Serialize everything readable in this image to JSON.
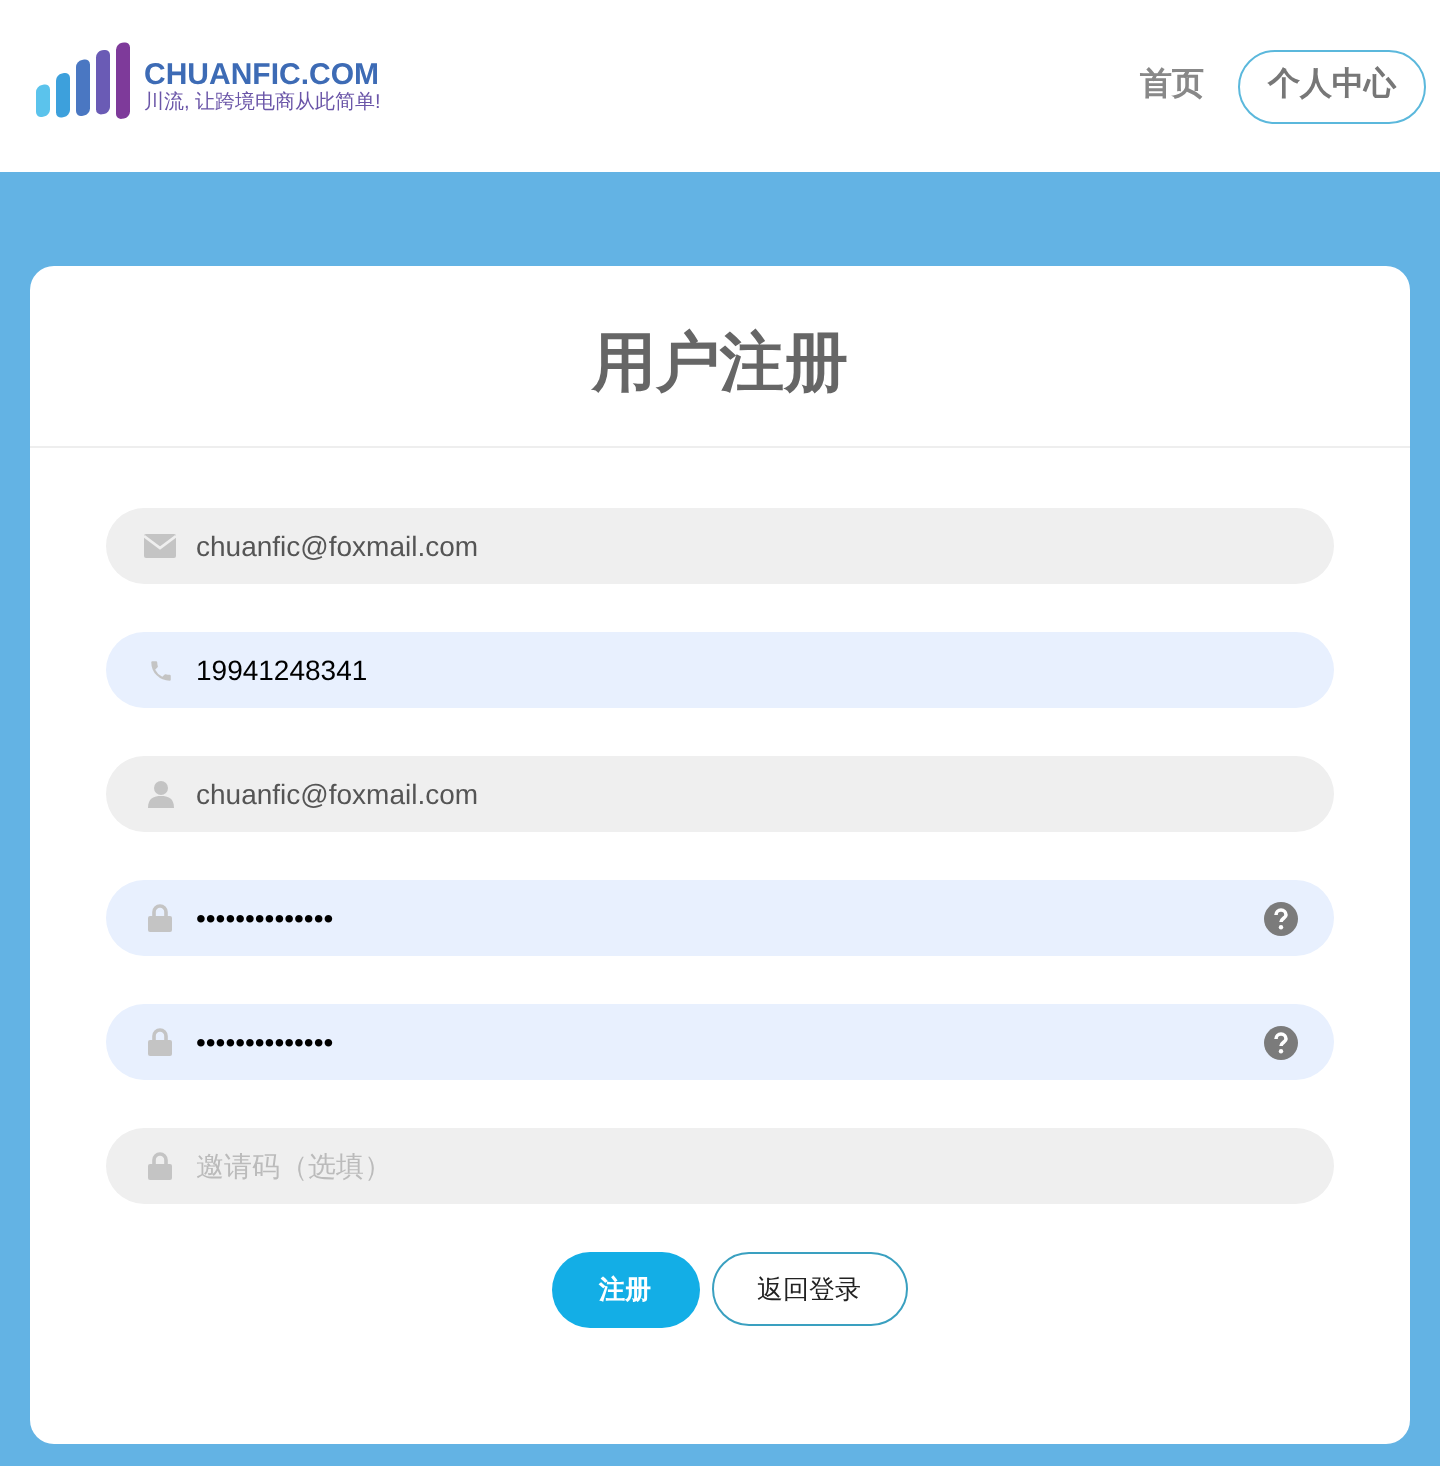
{
  "header": {
    "logo": {
      "name": "CHUANFIC.COM",
      "slogan": "川流, 让跨境电商从此简单!"
    },
    "nav": [
      {
        "label": "首页",
        "selected": false
      },
      {
        "label": "个人中心",
        "selected": true
      }
    ]
  },
  "form": {
    "title": "用户注册",
    "fields": [
      {
        "kind": "mail",
        "value": "chuanfic@foxmail.com",
        "autofilled": false,
        "help": false
      },
      {
        "kind": "phone",
        "value": "19941248341",
        "autofilled": true,
        "help": false
      },
      {
        "kind": "user",
        "value": "chuanfic@foxmail.com",
        "autofilled": false,
        "help": false
      },
      {
        "kind": "lock",
        "value": "••••••••••••••",
        "autofilled": true,
        "help": true
      },
      {
        "kind": "lock",
        "value": "••••••••••••••",
        "autofilled": true,
        "help": true
      },
      {
        "kind": "lock",
        "placeholder": "邀请码（选填）",
        "autofilled": false,
        "help": false
      }
    ],
    "buttons": [
      {
        "label": "注册",
        "kind": "primary"
      },
      {
        "label": "返回登录",
        "kind": "outline"
      }
    ]
  }
}
